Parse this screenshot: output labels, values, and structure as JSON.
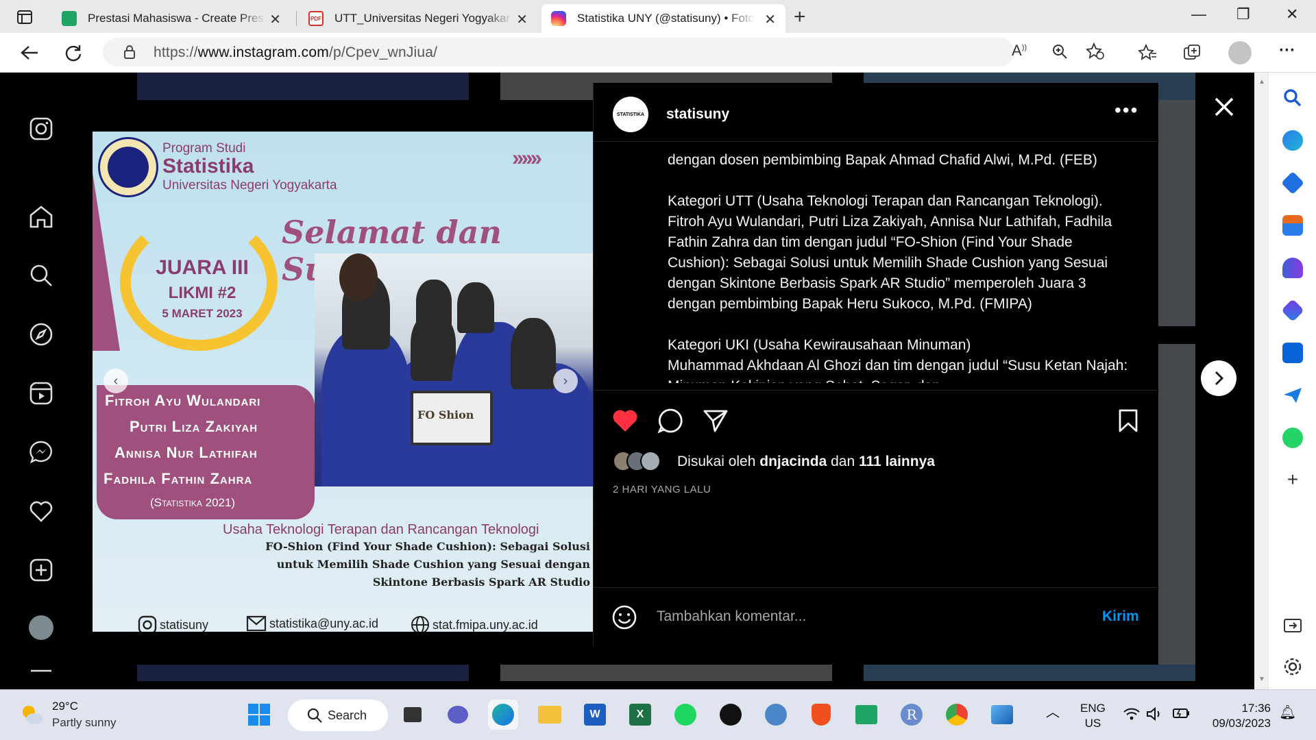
{
  "browser": {
    "tabs": [
      {
        "title": "Prestasi Mahasiswa - Create Pres",
        "active": false,
        "favicon_color": "#1fa463"
      },
      {
        "title": "UTT_Universitas Negeri Yogyakar",
        "active": false,
        "favicon_color": "#d93025"
      },
      {
        "title": "Statistika UNY (@statisuny) • Foto",
        "active": true,
        "favicon_color": "#e1306c"
      }
    ],
    "url_prefix": "https://",
    "url_domain": "www.instagram.com",
    "url_path": "/p/Cpev_wnJiua/"
  },
  "post_image": {
    "program": "Program Studi",
    "dept": "Statistika",
    "univ": "Universitas Negeri Yogyakarta",
    "arrows": "››››››",
    "congrats": "Selamat dan Sukses",
    "award": "JUARA III",
    "event": "LIKMI #2",
    "date": "5 MARET 2023",
    "laptop_text": "FO Shion",
    "names": [
      "Fitroh Ayu Wulandari",
      "Putri Liza Zakiyah",
      "Annisa Nur Lathifah",
      "Fadhila Fathin Zahra"
    ],
    "cohort": "(Statistika 2021)",
    "category": "Usaha Teknologi Terapan dan Rancangan Teknologi",
    "title_lines": [
      "FO-Shion (Find Your Shade Cushion): Sebagai Solusi",
      "untuk Memilih Shade Cushion yang Sesuai dengan",
      "Skintone Berbasis Spark AR Studio"
    ],
    "footer_ig": "statisuny",
    "footer_email": "statistika@uny.ac.id",
    "footer_web": "stat.fmipa.uny.ac.id"
  },
  "post": {
    "username": "statisuny",
    "avatar_text": "STATISTIKA",
    "caption": [
      "dengan dosen pembimbing Bapak Ahmad Chafid Alwi, M.Pd. (FEB)",
      "Kategori UTT (Usaha Teknologi Terapan dan Rancangan Teknologi).\nFitroh Ayu Wulandari, Putri Liza Zakiyah, Annisa Nur Lathifah, Fadhila Fathin Zahra dan tim dengan judul “FO-Shion (Find Your Shade Cushion): Sebagai Solusi untuk Memilih Shade Cushion yang Sesuai dengan Skintone Berbasis Spark AR Studio” memperoleh Juara 3 dengan pembimbing Bapak Heru Sukoco, M.Pd. (FMIPA)",
      "Kategori UKI (Usaha Kewirausahaan Minuman)\nMuhammad Akhdaan Al Ghozi dan tim dengan judul “Susu Ketan Najah: Minuman Kekinian yang Sehat, Segar, dan"
    ],
    "liked_prefix": "Disukai oleh",
    "liked_user": "dnjacinda",
    "liked_and": "dan",
    "liked_others": "111 lainnya",
    "time_ago": "2 HARI YANG LALU",
    "comment_placeholder": "Tambahkan komentar...",
    "send_label": "Kirim"
  },
  "taskbar": {
    "temperature": "29°C",
    "weather": "Partly sunny",
    "search_label": "Search",
    "lang_top": "ENG",
    "lang_bottom": "US",
    "time": "17:36",
    "date": "09/03/2023"
  },
  "colors": {
    "like": "#ff3040",
    "accent_link": "#0095f6",
    "brand_purple": "#a0507d"
  }
}
